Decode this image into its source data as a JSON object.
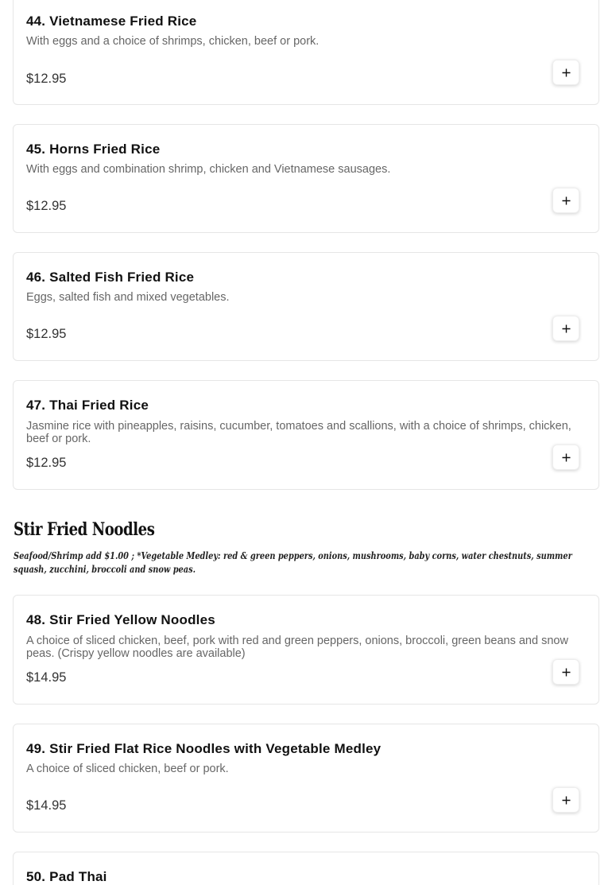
{
  "items_top": [
    {
      "title": "44. Vietnamese Fried Rice",
      "description": "With eggs and a choice of shrimps, chicken, beef or pork.",
      "price": "$12.95",
      "add_icon": "plus-icon"
    },
    {
      "title": "45. Horns Fried Rice",
      "description": "With eggs and combination shrimp, chicken and Vietnamese sausages.",
      "price": "$12.95",
      "add_icon": "plus-icon"
    },
    {
      "title": "46. Salted Fish Fried Rice",
      "description": "Eggs, salted fish and mixed vegetables.",
      "price": "$12.95",
      "add_icon": "plus-icon"
    },
    {
      "title": "47. Thai Fried Rice",
      "description": "Jasmine rice with pineapples, raisins, cucumber, tomatoes and scallions, with a choice of shrimps, chicken, beef or pork.",
      "price": "$12.95",
      "add_icon": "plus-icon"
    }
  ],
  "section": {
    "title": "Stir Fried Noodles",
    "note": "Seafood/Shrimp add $1.00 ; *Vegetable Medley: red & green peppers, onions, mushrooms, baby corns, water chestnuts, summer squash, zucchini, broccoli and snow peas."
  },
  "items_noodles": [
    {
      "title": "48. Stir Fried Yellow Noodles",
      "description": "A choice of sliced chicken, beef, pork with red and green peppers, onions, broccoli, green beans and snow peas. (Crispy yellow noodles are available)",
      "price": "$14.95",
      "add_icon": "plus-icon"
    },
    {
      "title": "49. Stir Fried Flat Rice Noodles with Vegetable Medley",
      "description": "A choice of sliced chicken, beef or pork.",
      "price": "$14.95",
      "add_icon": "plus-icon"
    },
    {
      "title": "50. Pad Thai"
    }
  ],
  "colors": {
    "title": "#111111",
    "description": "#666666",
    "price": "#333333",
    "card_border": "#e6e6e6"
  }
}
